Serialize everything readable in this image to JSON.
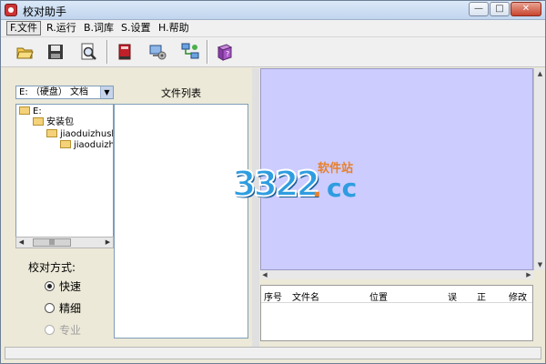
{
  "window": {
    "title": "校对助手",
    "controls": {
      "minimize": "—",
      "maximize": "□",
      "close": "✕"
    }
  },
  "menu": [
    {
      "key": "F",
      "label": "F.文件"
    },
    {
      "key": "R",
      "label": "R.运行"
    },
    {
      "key": "B",
      "label": "B.词库"
    },
    {
      "key": "S",
      "label": "S.设置"
    },
    {
      "key": "H",
      "label": "H.帮助"
    }
  ],
  "toolbar": [
    {
      "icon": "open-folder-icon"
    },
    {
      "icon": "save-disk-icon"
    },
    {
      "icon": "search-document-icon"
    },
    {
      "icon": "dictionary-book-icon"
    },
    {
      "icon": "settings-computer-icon"
    },
    {
      "icon": "network-icon"
    },
    {
      "icon": "help-book-icon"
    }
  ],
  "drive_select": {
    "value": "E: （硬盘） 文档"
  },
  "tree": [
    {
      "label": "E:"
    },
    {
      "label": "安装包"
    },
    {
      "label": "jiaoduizhush"
    },
    {
      "label": "jiaoduizh"
    }
  ],
  "tree_scroll": {
    "thumb": "|||"
  },
  "file_list": {
    "title": "文件列表"
  },
  "mode": {
    "label": "校对方式:",
    "options": [
      {
        "label": "快速",
        "checked": true,
        "enabled": true
      },
      {
        "label": "精细",
        "checked": false,
        "enabled": true
      },
      {
        "label": "专业",
        "checked": false,
        "enabled": false
      }
    ]
  },
  "results": {
    "columns": [
      "序号",
      "文件名",
      "位置",
      "误",
      "正",
      "修改"
    ]
  },
  "watermark": {
    "number": "3322",
    "dot": ".",
    "domain": "cc",
    "cn": "软件站"
  },
  "colors": {
    "doc_view_bg": "#ccccff",
    "watermark_blue": "#2e9de0",
    "watermark_orange": "#e8802b"
  }
}
